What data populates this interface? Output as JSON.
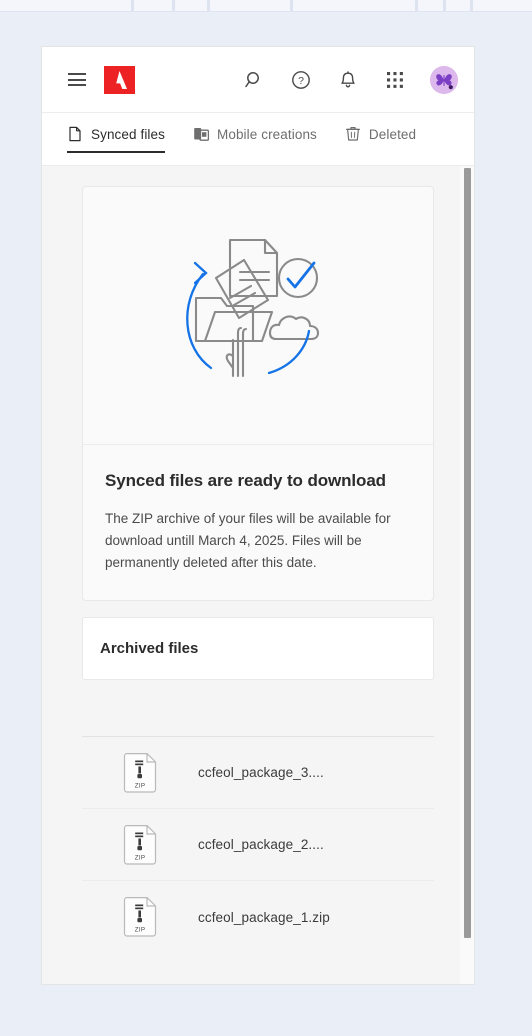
{
  "header": {
    "menu_icon": "hamburger-menu-icon",
    "logo": "adobe-logo",
    "icons": [
      {
        "name": "search-icon",
        "label": "Search"
      },
      {
        "name": "help-icon",
        "label": "Help"
      },
      {
        "name": "notifications-bell-icon",
        "label": "Notifications"
      },
      {
        "name": "app-grid-icon",
        "label": "Apps"
      }
    ],
    "avatar": {
      "name": "user-avatar",
      "label": "Account",
      "glyph": "butterfly",
      "background": "#dcb8ed"
    }
  },
  "tabs": [
    {
      "label": "Synced files",
      "icon": "document-icon",
      "active": true
    },
    {
      "label": "Mobile creations",
      "icon": "mobile-device-icon",
      "active": false
    },
    {
      "label": "Deleted",
      "icon": "trash-icon",
      "active": false
    }
  ],
  "hero": {
    "illustration": "sync-files-to-cloud-illustration",
    "title": "Synced files are ready to download",
    "body": "The ZIP archive of your files will be available for download untill March 4, 2025. Files will be permanently deleted after this date."
  },
  "archived": {
    "title": "Archived files"
  },
  "files": [
    {
      "name": "ccfeol_package_3....",
      "type": "ZIP",
      "icon": "zip-file-icon"
    },
    {
      "name": "ccfeol_package_2....",
      "type": "ZIP",
      "icon": "zip-file-icon"
    },
    {
      "name": "ccfeol_package_1.zip",
      "type": "ZIP",
      "icon": "zip-file-icon"
    }
  ],
  "colors": {
    "adobe_red": "#ed2224",
    "accent_blue": "#1473e6",
    "page_background": "#eaeef7",
    "content_background": "#f5f5f5",
    "text_primary": "#2c2c2c",
    "text_secondary": "#6e6e6e"
  },
  "scrollbar": {
    "name": "vertical-scrollbar"
  }
}
